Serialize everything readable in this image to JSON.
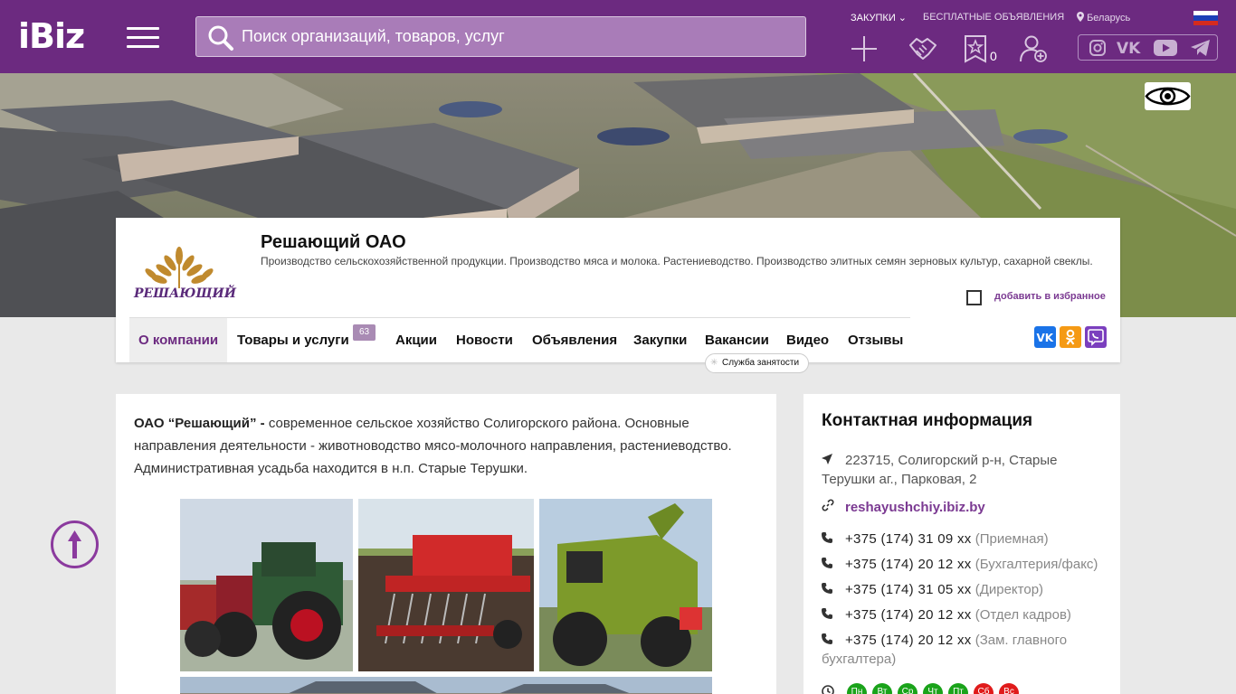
{
  "header": {
    "logo": "iBiz",
    "search_placeholder": "Поиск организаций, товаров, услуг",
    "links": {
      "purchases": "ЗАКУПКИ",
      "free_ads": "БЕСПЛАТНЫЕ ОБЪЯВЛЕНИЯ",
      "region": "Беларусь"
    },
    "favorites_count": "0",
    "icons": [
      "plus-icon",
      "handshake-icon",
      "star-icon",
      "add-user-icon",
      "instagram-icon",
      "vk-icon",
      "youtube-icon",
      "telegram-icon"
    ]
  },
  "company": {
    "name": "Решающий ОАО",
    "logo_text": "РЕШАЮЩИЙ",
    "description": "Производство сельскохозяйственной продукции. Производство мяса и молока. Растениеводство. Производство элитных семян зерновых культур, сахарной свеклы.",
    "add_favorite": "добавить в избранное"
  },
  "tabs": [
    {
      "label": "О компании"
    },
    {
      "label": "Товары и услуги",
      "badge": "63"
    },
    {
      "label": "Акции"
    },
    {
      "label": "Новости"
    },
    {
      "label": "Объявления"
    },
    {
      "label": "Закупки"
    },
    {
      "label": "Вакансии",
      "sub_badge": "Служба занятости"
    },
    {
      "label": "Видео"
    },
    {
      "label": "Отзывы"
    }
  ],
  "about": {
    "lead": "ОАО “Решающий” -",
    "text": " современное сельское хозяйство  Солигорского района. Основные направления деятельности -  животноводство мясо-молочного направления, растениеводство. Административная усадьба находится в н.п. Старые Терушки."
  },
  "contacts": {
    "title": "Контактная информация",
    "address": "223715, Солигорский р-н, Старые Терушки аг., Парковая, 2",
    "website": "reshayushchiy.ibiz.by",
    "phones": [
      {
        "number": "+375 (174) 31 09 xx",
        "note": "(Приемная)"
      },
      {
        "number": "+375 (174) 20 12 xx",
        "note": "(Бухгалтерия/факс)"
      },
      {
        "number": "+375 (174) 31 05 xx",
        "note": "(Директор)"
      },
      {
        "number": "+375 (174) 20 12 xx",
        "note": "(Отдел кадров)"
      },
      {
        "number": "+375 (174) 20 12 xx",
        "note": "(Зам. главного бухгалтера)"
      }
    ],
    "days": [
      {
        "label": "Пн",
        "status": "open"
      },
      {
        "label": "Вт",
        "status": "open"
      },
      {
        "label": "Ср",
        "status": "open"
      },
      {
        "label": "Чт",
        "status": "open"
      },
      {
        "label": "Пт",
        "status": "open"
      },
      {
        "label": "Сб",
        "status": "closed"
      },
      {
        "label": "Вс",
        "status": "closed"
      }
    ]
  },
  "colors": {
    "brand": "#6c2a80",
    "accent_link": "#7b3a92",
    "day_open": "#1aa31a",
    "day_closed": "#e01b1b"
  }
}
